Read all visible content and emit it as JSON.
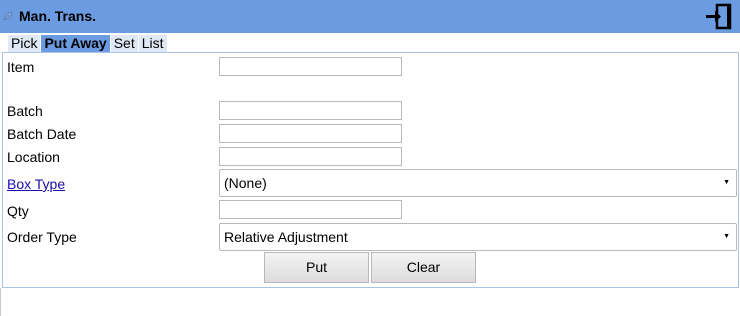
{
  "header": {
    "title": "Man. Trans.",
    "leaf_icon": "leaf-icon",
    "exit_icon": "exit-door-icon",
    "bar_color": "#6b9be0"
  },
  "tabs": [
    {
      "label": "Pick",
      "active": false
    },
    {
      "label": "Put Away",
      "active": true
    },
    {
      "label": "Set",
      "active": false
    },
    {
      "label": "List",
      "active": false
    }
  ],
  "form": {
    "item": {
      "label": "Item",
      "value": ""
    },
    "batch": {
      "label": "Batch",
      "value": ""
    },
    "batch_date": {
      "label": "Batch Date",
      "value": ""
    },
    "location": {
      "label": "Location",
      "value": ""
    },
    "box_type": {
      "label": "Box Type",
      "selected": "(None)"
    },
    "qty": {
      "label": "Qty",
      "value": ""
    },
    "order_type": {
      "label": "Order Type",
      "selected": "Relative Adjustment"
    }
  },
  "buttons": {
    "put": "Put",
    "clear": "Clear"
  }
}
